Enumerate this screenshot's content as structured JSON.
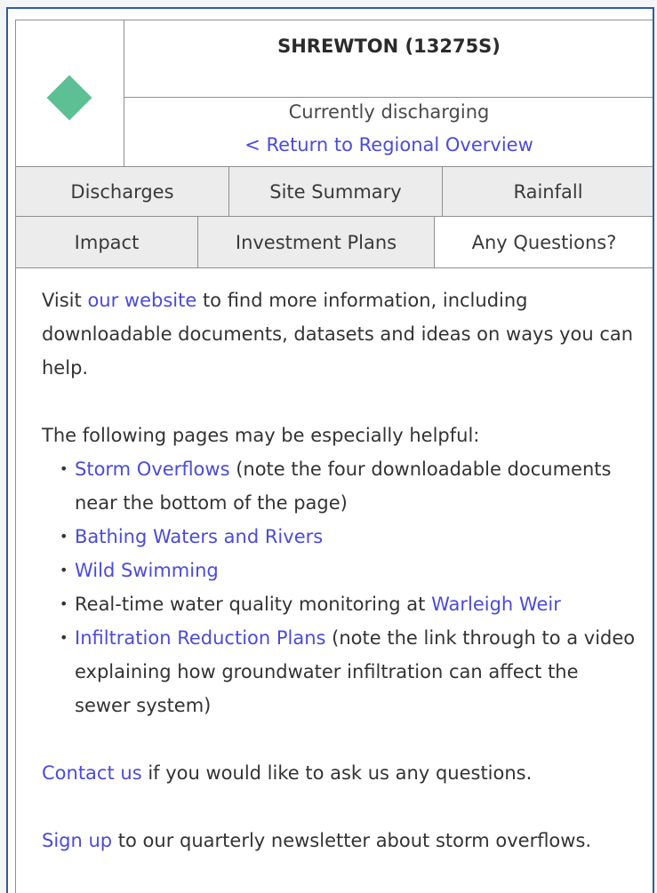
{
  "site": {
    "title": "SHREWTON (13275S)",
    "status": "Currently discharging",
    "return_link": "< Return to Regional Overview",
    "symbol_color": "#5dbf94",
    "symbol_icon": "diamond-icon"
  },
  "tabs": {
    "row1": [
      {
        "label": "Discharges"
      },
      {
        "label": "Site Summary"
      },
      {
        "label": "Rainfall"
      }
    ],
    "row2": [
      {
        "label": "Impact"
      },
      {
        "label": "Investment Plans"
      },
      {
        "label": "Any Questions?",
        "active": true
      }
    ]
  },
  "content": {
    "intro_link": "our website",
    "intro_pre": "Visit ",
    "intro_post": " to find more information, including downloadable documents, datasets and ideas on ways you can help.",
    "helpful_heading": "The following pages may be especially helpful:",
    "items": [
      {
        "link": "Storm Overflows",
        "pre": "",
        "post": " (note the four downloadable documents near the bottom of the page)"
      },
      {
        "link": "Bathing Waters and Rivers",
        "pre": "",
        "post": ""
      },
      {
        "link": "Wild Swimming",
        "pre": "",
        "post": ""
      },
      {
        "link": "Warleigh Weir",
        "pre": "Real-time water quality monitoring at ",
        "post": ""
      },
      {
        "link": "Infiltration Reduction Plans",
        "pre": "",
        "post": " (note the link through to a video explaining how groundwater infiltration can affect the sewer system)"
      }
    ],
    "contact_link": "Contact us",
    "contact_post": " if you would like to ask us any questions.",
    "signup_link": "Sign up",
    "signup_post": " to our quarterly newsletter about storm overflows."
  },
  "colors": {
    "link": "#4b4bd9",
    "panel_border": "#2e5ba6",
    "tab_bg": "#ececec"
  }
}
